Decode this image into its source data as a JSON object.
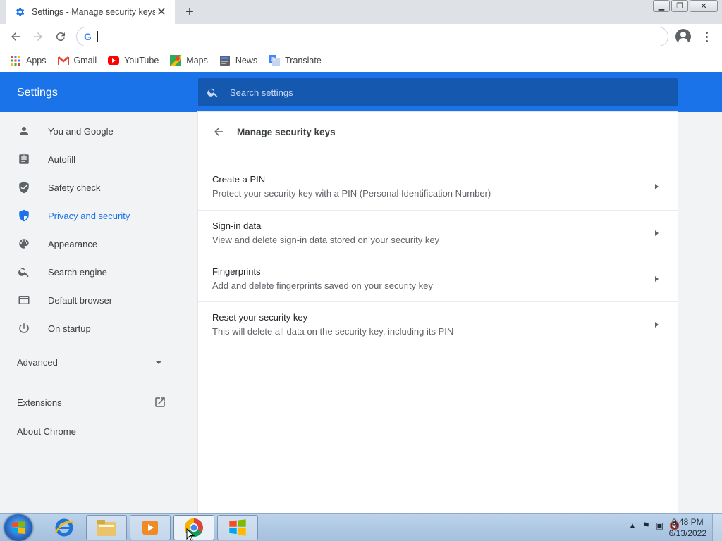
{
  "browser": {
    "tab_title": "Settings - Manage security keys",
    "omnibox_value": "",
    "bookmarks": [
      {
        "label": "Apps",
        "icon": "apps-grid-icon"
      },
      {
        "label": "Gmail",
        "icon": "gmail-icon"
      },
      {
        "label": "YouTube",
        "icon": "youtube-icon"
      },
      {
        "label": "Maps",
        "icon": "maps-icon"
      },
      {
        "label": "News",
        "icon": "news-icon"
      },
      {
        "label": "Translate",
        "icon": "translate-icon"
      }
    ]
  },
  "settings": {
    "header_title": "Settings",
    "search_placeholder": "Search settings",
    "sidebar": {
      "items": [
        {
          "label": "You and Google",
          "icon": "person-icon",
          "active": false
        },
        {
          "label": "Autofill",
          "icon": "clipboard-icon",
          "active": false
        },
        {
          "label": "Safety check",
          "icon": "shield-check-icon",
          "active": false
        },
        {
          "label": "Privacy and security",
          "icon": "shield-icon",
          "active": true
        },
        {
          "label": "Appearance",
          "icon": "palette-icon",
          "active": false
        },
        {
          "label": "Search engine",
          "icon": "search-icon",
          "active": false
        },
        {
          "label": "Default browser",
          "icon": "browser-window-icon",
          "active": false
        },
        {
          "label": "On startup",
          "icon": "power-icon",
          "active": false
        }
      ],
      "advanced_label": "Advanced",
      "extensions_label": "Extensions",
      "about_label": "About Chrome"
    },
    "page": {
      "title": "Manage security keys",
      "rows": [
        {
          "title": "Create a PIN",
          "subtitle": "Protect your security key with a PIN (Personal Identification Number)"
        },
        {
          "title": "Sign-in data",
          "subtitle": "View and delete sign-in data stored on your security key"
        },
        {
          "title": "Fingerprints",
          "subtitle": "Add and delete fingerprints saved on your security key"
        },
        {
          "title": "Reset your security key",
          "subtitle": "This will delete all data on the security key, including its PIN"
        }
      ]
    }
  },
  "taskbar": {
    "time": "9:48 PM",
    "date": "6/13/2022"
  },
  "colors": {
    "accent": "#1a73e8",
    "search_bg": "#1558b0",
    "sidebar_bg": "#f1f3f4"
  }
}
